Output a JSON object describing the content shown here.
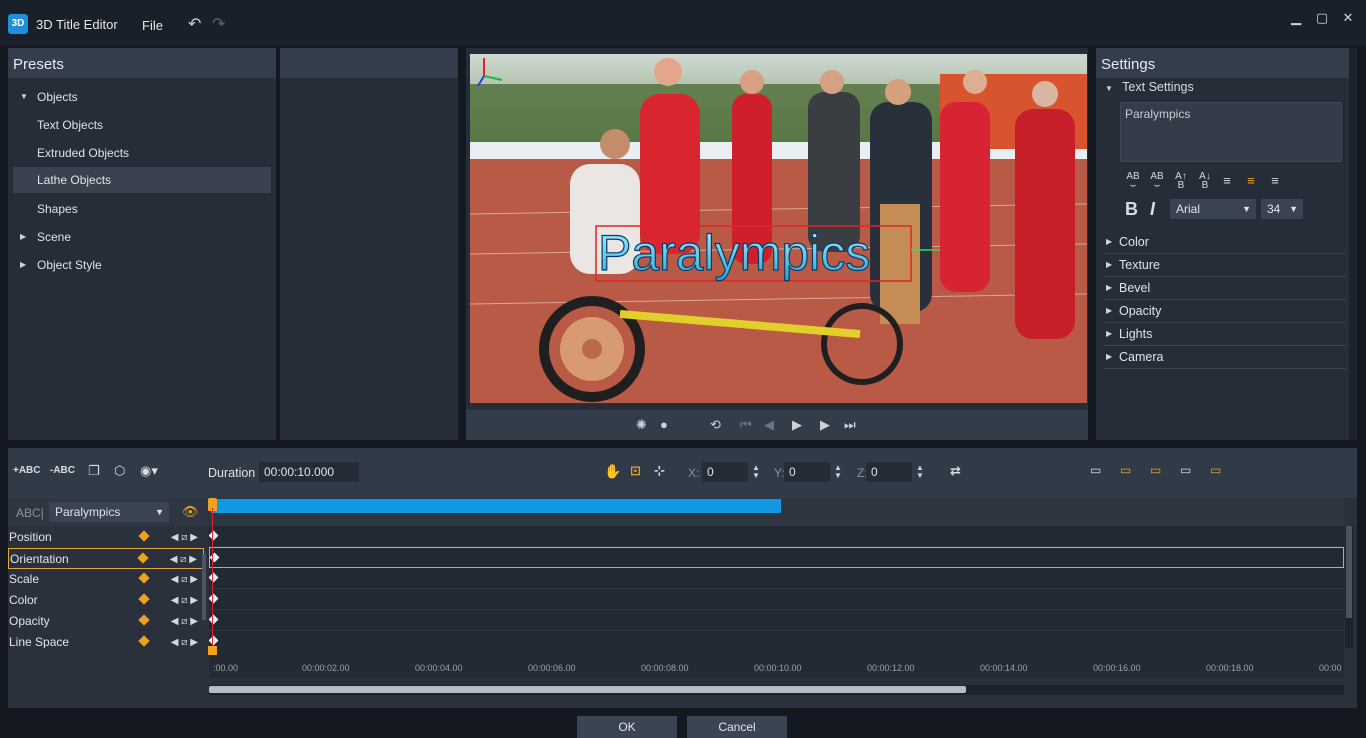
{
  "window": {
    "app_icon_text": "3D",
    "title": "3D Title Editor",
    "menu_file": "File"
  },
  "presets": {
    "header": "Presets",
    "items": [
      {
        "label": "Objects",
        "expanded": true
      },
      {
        "label": "Text Objects"
      },
      {
        "label": "Extruded Objects"
      },
      {
        "label": "Lathe Objects",
        "selected": true
      },
      {
        "label": "Shapes"
      },
      {
        "label": "Scene"
      },
      {
        "label": "Object Style"
      }
    ]
  },
  "preview": {
    "overlay_text": "Paralympics"
  },
  "settings": {
    "header": "Settings",
    "text_settings_label": "Text Settings",
    "text_value": "Paralympics",
    "font": "Arial",
    "size": "34",
    "bold": "B",
    "italic": "I",
    "sections": [
      "Color",
      "Texture",
      "Bevel",
      "Opacity",
      "Lights",
      "Camera"
    ]
  },
  "timeline": {
    "add_text": "+ABC",
    "remove_text": "-ABC",
    "duration_label": "Duration",
    "duration_value": "00:00:10.000",
    "x_label": "X:",
    "x_value": "0",
    "y_label": "Y:",
    "y_value": "0",
    "z_label": "Z:",
    "z_value": "0",
    "abc_label": "ABC|",
    "object_select": "Paralympics",
    "tracks": [
      "Position",
      "Orientation",
      "Scale",
      "Color",
      "Opacity",
      "Line Space"
    ],
    "selected_track": "Orientation",
    "ticks": [
      ":00.00",
      "00:00:02.00",
      "00:00:04.00",
      "00:00:06.00",
      "00:00:08.00",
      "00:00:10.00",
      "00:00:12.00",
      "00:00:14.00",
      "00:00:16.00",
      "00:00:18.00",
      "00:00"
    ]
  },
  "footer": {
    "ok": "OK",
    "cancel": "Cancel"
  },
  "colors": {
    "accent_orange": "#f0a21f",
    "clip_blue": "#1199e4",
    "selection_border": "#e8a33a"
  }
}
